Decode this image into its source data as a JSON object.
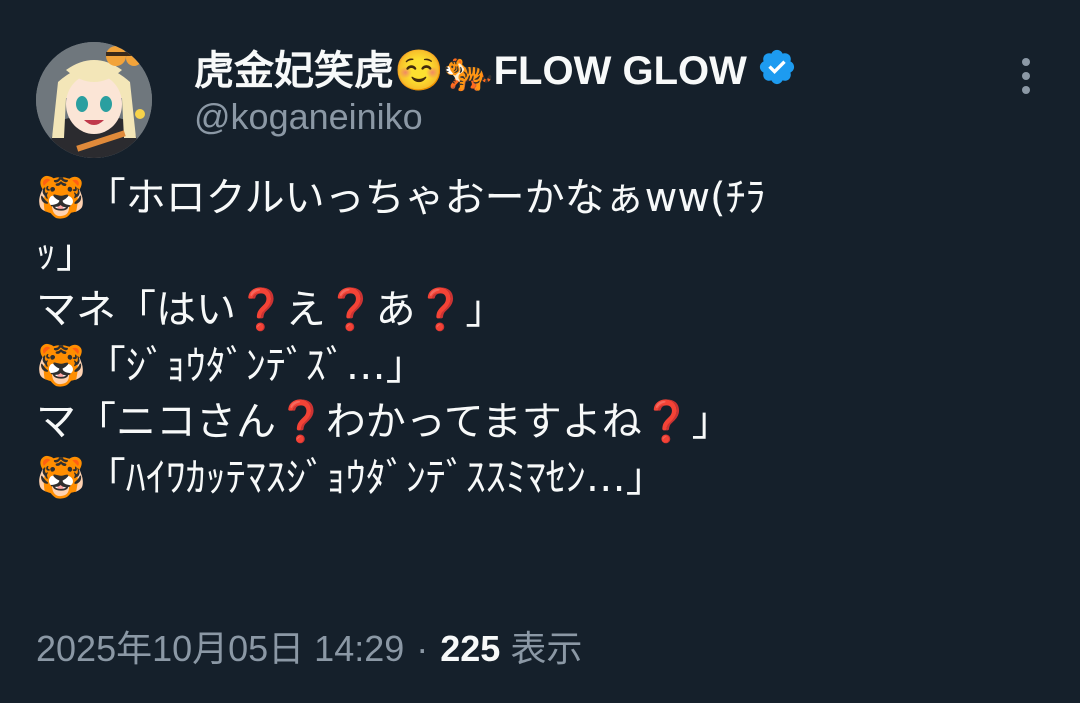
{
  "user": {
    "display_name": "虎金妃笑虎☺️🐅FLOW GLOW",
    "handle": "@koganeiniko",
    "verified_color": "#1d9bf0"
  },
  "more_menu": {
    "icon": "more-vertical-icon"
  },
  "tweet": {
    "lines": [
      "🐯「ホロクルいっちゃおーかなぁww(ﾁﾗ",
      "ｯ」",
      "マネ「はい❓え❓あ❓」",
      "🐯「ｼﾞｮｳﾀﾞﾝﾃﾞｽﾞ…」",
      "マ「ニコさん❓わかってますよね❓」",
      "🐯「ﾊｲﾜｶｯﾃﾏｽｼﾞｮｳﾀﾞﾝﾃﾞｽｽﾐﾏｾﾝ…」"
    ]
  },
  "meta": {
    "timestamp": "2025年10月05日 14:29",
    "separator": "·",
    "views": "225",
    "views_label": "表示"
  }
}
